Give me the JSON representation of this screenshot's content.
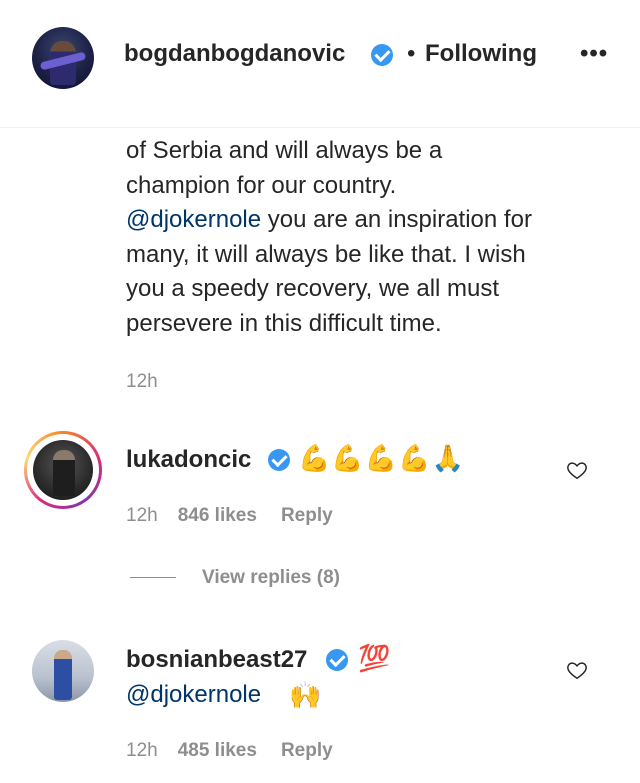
{
  "post": {
    "username": "bogdanbogdanovic",
    "separator": "•",
    "follow_label": "Following",
    "more_label": "•••"
  },
  "caption": {
    "lines": [
      "of Serbia and will always be a",
      "champion for our country."
    ],
    "mention": "@djokernole",
    "mention_rest": " you are an inspiration for",
    "lines_after": [
      "many, it will always be like that. I wish",
      "you a speedy recovery, we all must",
      "persevere in this difficult time."
    ],
    "time": "12h"
  },
  "comments": [
    {
      "username": "lukadoncic",
      "text": "💪💪💪💪🙏",
      "time": "12h",
      "likes": "846 likes",
      "reply_label": "Reply",
      "view_replies": "View replies (8)"
    },
    {
      "username": "bosnianbeast27",
      "text": "💯",
      "mention": "@djokernole",
      "text2": "🙌",
      "time": "12h",
      "likes": "485 likes",
      "reply_label": "Reply"
    }
  ],
  "colors": {
    "verified": "#3897f0",
    "mention": "#003569",
    "muted": "#8e8e8e",
    "text": "#262626"
  },
  "icons": {
    "verified": "verified-badge-icon",
    "heart": "heart-outline-icon",
    "more": "more-options-icon"
  }
}
